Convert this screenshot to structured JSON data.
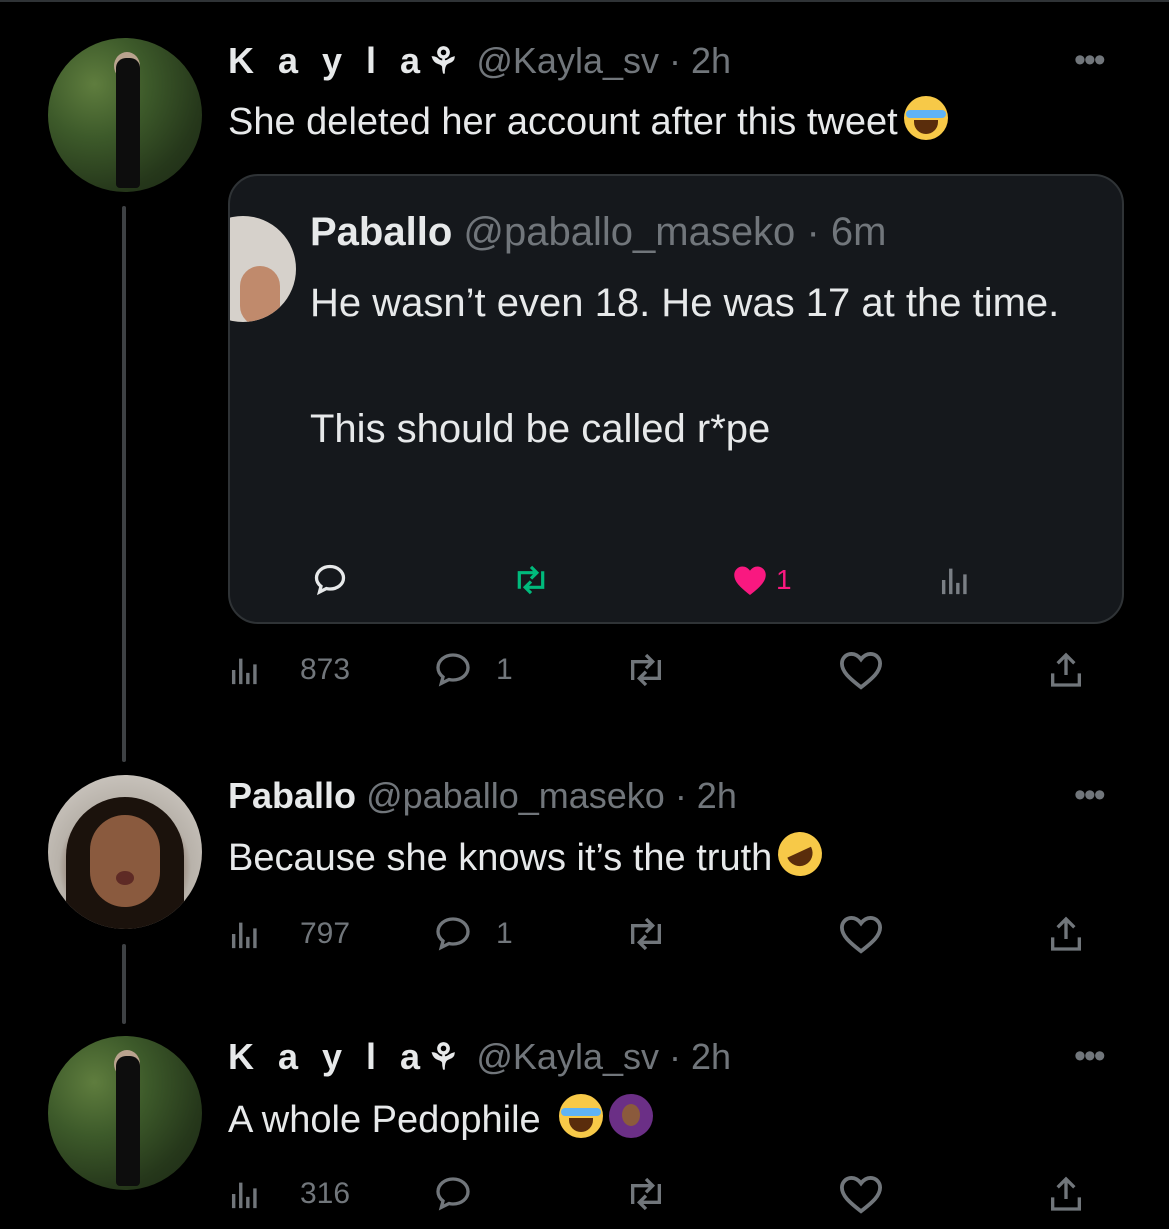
{
  "tweets": [
    {
      "name": "K a y l a⚘",
      "handle": "@Kayla_sv",
      "time": "· 2h",
      "text": "She deleted her account after this tweet",
      "emoji": [
        "loudly-crying-face"
      ],
      "quoted": {
        "name": "Paballo",
        "handle": "@paballo_maseko",
        "time": "· 6m",
        "lines": [
          "He wasn’t even 18. He was 17 at the time.",
          "This should be called r*pe"
        ],
        "likes": "1",
        "like_color": "#f91880"
      },
      "views": "873",
      "replies": "1"
    },
    {
      "name": "Paballo",
      "handle": "@paballo_maseko",
      "time": "· 2h",
      "text": "Because she knows it’s the truth",
      "emoji": [
        "rolling-on-floor-laughing-face"
      ],
      "views": "797",
      "replies": "1"
    },
    {
      "name": "K a y l a⚘",
      "handle": "@Kayla_sv",
      "time": "· 2h",
      "text": "A whole Pedophile",
      "emoji": [
        "loudly-crying-face",
        "person-gesturing-ok"
      ],
      "views": "316",
      "replies": ""
    }
  ],
  "more_label": "•••",
  "colors": {
    "background": "#000000",
    "text": "#e7e9ea",
    "muted": "#71767b",
    "quote_bg": "#15181c",
    "like": "#f91880"
  }
}
